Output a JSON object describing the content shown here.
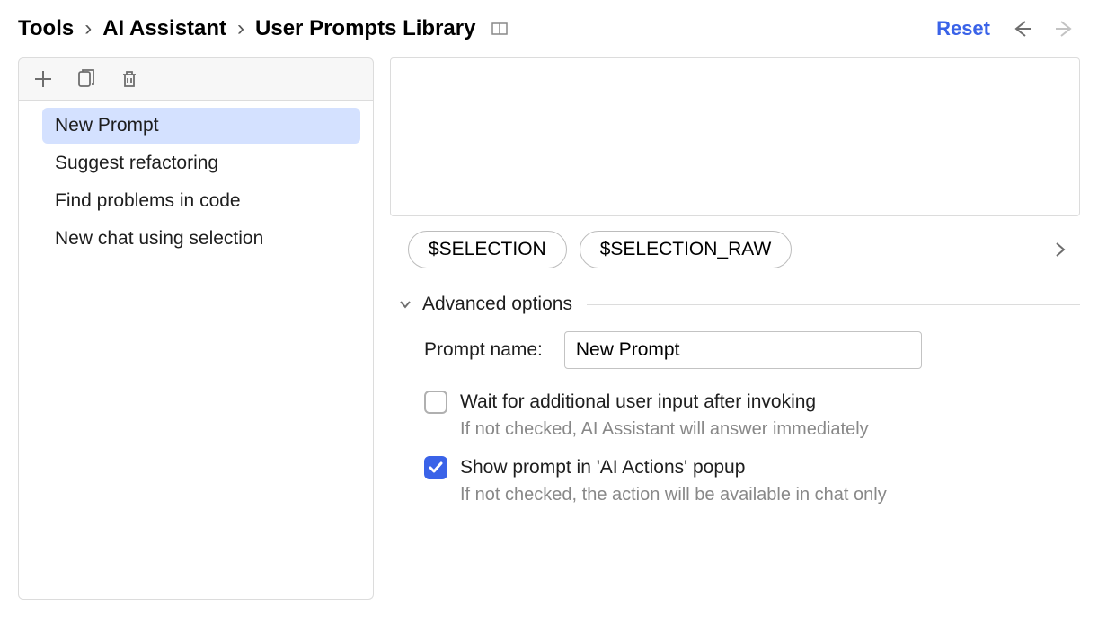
{
  "breadcrumb": {
    "0": "Tools",
    "1": "AI Assistant",
    "2": "User Prompts Library"
  },
  "header": {
    "reset": "Reset"
  },
  "sidebar": {
    "items": [
      {
        "label": "New Prompt"
      },
      {
        "label": "Suggest refactoring"
      },
      {
        "label": "Find problems in code"
      },
      {
        "label": "New chat using selection"
      }
    ]
  },
  "pills": [
    {
      "label": "$SELECTION"
    },
    {
      "label": "$SELECTION_RAW"
    }
  ],
  "advanced": {
    "title": "Advanced options",
    "prompt_name_label": "Prompt name:",
    "prompt_name_value": "New Prompt",
    "wait_label": "Wait for additional user input after invoking",
    "wait_help": "If not checked, AI Assistant will answer immediately",
    "show_label": "Show prompt in 'AI Actions' popup",
    "show_help": "If not checked, the action will be available in chat only"
  }
}
